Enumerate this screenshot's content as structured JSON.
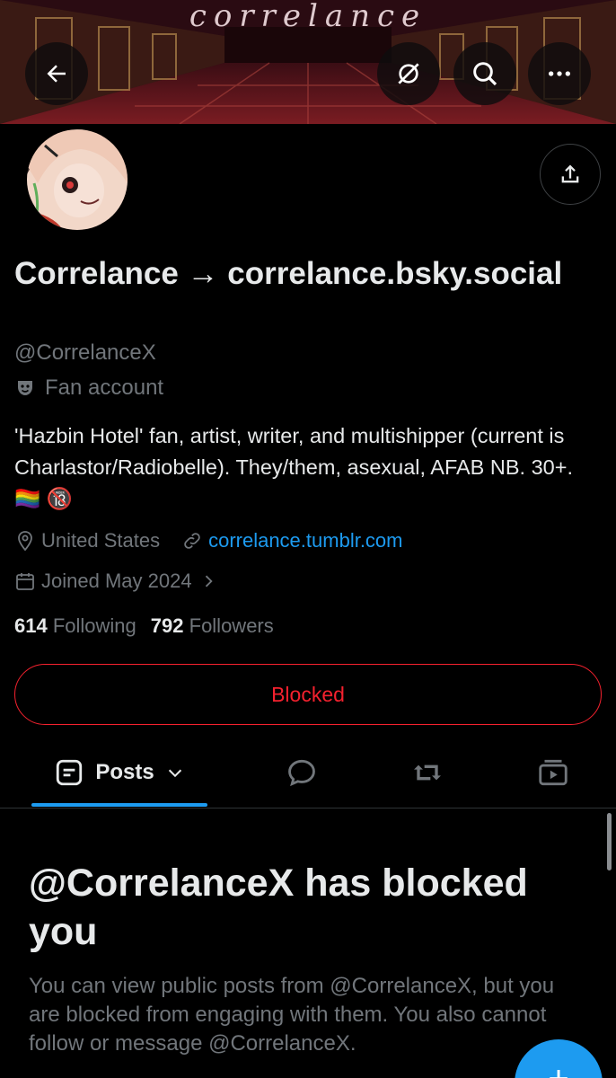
{
  "banner": {
    "title": "correlance"
  },
  "profile": {
    "display_name": "Correlance → correlance.bsky.social",
    "handle": "@CorrelanceX",
    "category": "Fan account",
    "bio": "'Hazbin Hotel' fan, artist, writer, and multishipper (current is Charlastor/Radiobelle). They/them, asexual, AFAB NB. 30+. 🏳️‍🌈 🔞",
    "location": "United States",
    "website": "correlance.tumblr.com",
    "joined": "Joined May 2024",
    "following_count": "614",
    "following_label": "Following",
    "followers_count": "792",
    "followers_label": "Followers"
  },
  "actions": {
    "blocked_label": "Blocked"
  },
  "tabs": {
    "posts_label": "Posts"
  },
  "blocked_notice": {
    "title": "@CorrelanceX has blocked you",
    "description": "You can view public posts from @CorrelanceX, but you are blocked from engaging with them. You also cannot follow or message @CorrelanceX."
  },
  "colors": {
    "accent": "#1d9bf0",
    "danger": "#f4212e",
    "muted": "#71767b",
    "text": "#e7e9ea"
  },
  "icons": [
    "back-arrow-icon",
    "hide-reposts-icon",
    "search-icon",
    "more-icon",
    "share-icon",
    "theater-mask-icon",
    "location-pin-icon",
    "link-icon",
    "calendar-icon",
    "chevron-right-icon",
    "posts-icon",
    "chevron-down-icon",
    "replies-icon",
    "repost-icon",
    "media-icon",
    "compose-icon"
  ]
}
